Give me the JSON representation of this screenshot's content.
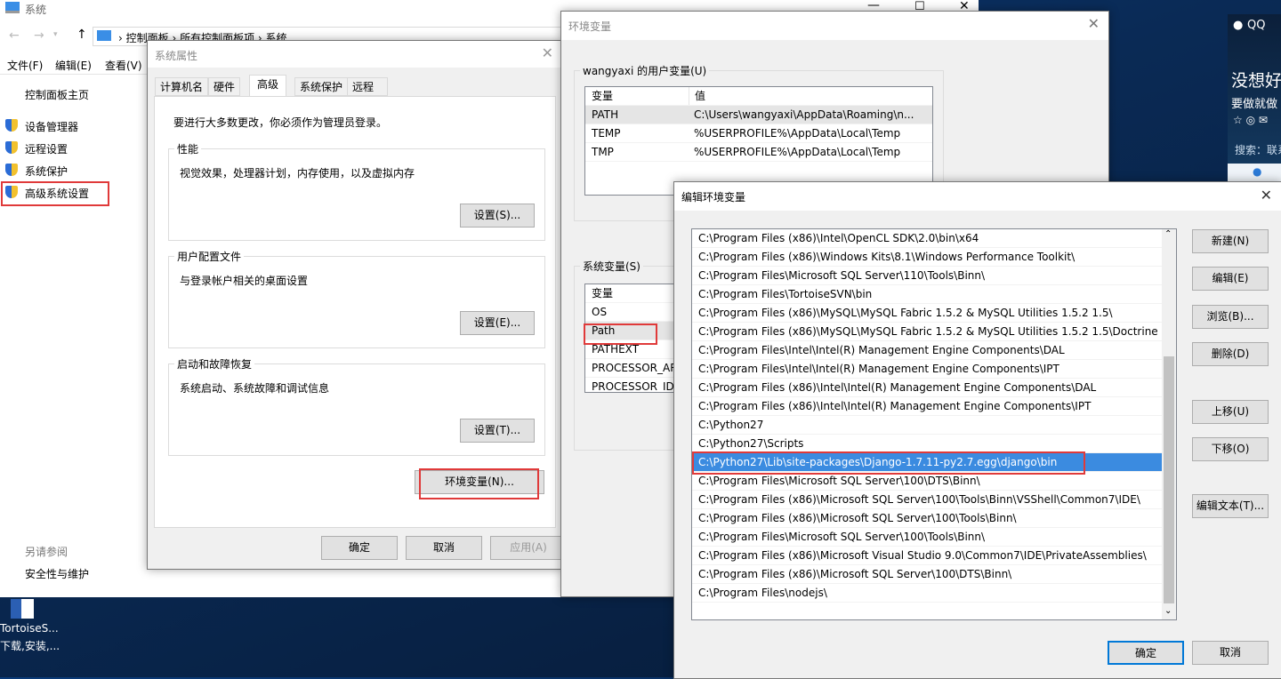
{
  "control_panel": {
    "title": "系统",
    "breadcrumb": [
      "控制面板",
      "所有控制面板项",
      "系统"
    ],
    "menu": [
      "文件(F)",
      "编辑(E)",
      "查看(V)"
    ],
    "home": "控制面板主页",
    "links": [
      "设备管理器",
      "远程设置",
      "系统保护",
      "高级系统设置"
    ],
    "see_also": "另请参阅",
    "security": "安全性与维护"
  },
  "desktop": {
    "icon_label_1": "TortoiseS...",
    "icon_label_2": "下载,安装,..."
  },
  "qq": {
    "title": "QQ",
    "line1": "没想好",
    "line2": "要做就做",
    "search": "搜索：联系"
  },
  "sysprops": {
    "title": "系统属性",
    "tabs": [
      "计算机名",
      "硬件",
      "高级",
      "系统保护",
      "远程"
    ],
    "active_tab": "高级",
    "admin_note": "要进行大多数更改，你必须作为管理员登录。",
    "perf": {
      "label": "性能",
      "desc": "视觉效果，处理器计划，内存使用，以及虚拟内存",
      "btn": "设置(S)..."
    },
    "profile": {
      "label": "用户配置文件",
      "desc": "与登录帐户相关的桌面设置",
      "btn": "设置(E)..."
    },
    "startup": {
      "label": "启动和故障恢复",
      "desc": "系统启动、系统故障和调试信息",
      "btn": "设置(T)..."
    },
    "env_btn": "环境变量(N)...",
    "ok": "确定",
    "cancel": "取消",
    "apply": "应用(A)"
  },
  "envvars": {
    "title": "环境变量",
    "user_group": "wangyaxi 的用户变量(U)",
    "col_var": "变量",
    "col_val": "值",
    "user_vars": [
      {
        "name": "PATH",
        "value": "C:\\Users\\wangyaxi\\AppData\\Roaming\\n..."
      },
      {
        "name": "TEMP",
        "value": "%USERPROFILE%\\AppData\\Local\\Temp"
      },
      {
        "name": "TMP",
        "value": "%USERPROFILE%\\AppData\\Local\\Temp"
      }
    ],
    "sys_group": "系统变量(S)",
    "sys_vars": [
      "OS",
      "Path",
      "PATHEXT",
      "PROCESSOR_AR",
      "PROCESSOR_IDE"
    ]
  },
  "edit": {
    "title": "编辑环境变量",
    "selected_index": 12,
    "paths": [
      "C:\\Program Files (x86)\\Intel\\OpenCL SDK\\2.0\\bin\\x64",
      "C:\\Program Files (x86)\\Windows Kits\\8.1\\Windows Performance Toolkit\\",
      "C:\\Program Files\\Microsoft SQL Server\\110\\Tools\\Binn\\",
      "C:\\Program Files\\TortoiseSVN\\bin",
      "C:\\Program Files (x86)\\MySQL\\MySQL Fabric 1.5.2 & MySQL Utilities 1.5.2 1.5\\",
      "C:\\Program Files (x86)\\MySQL\\MySQL Fabric 1.5.2 & MySQL Utilities 1.5.2 1.5\\Doctrine ...",
      "C:\\Program Files\\Intel\\Intel(R) Management Engine Components\\DAL",
      "C:\\Program Files\\Intel\\Intel(R) Management Engine Components\\IPT",
      "C:\\Program Files (x86)\\Intel\\Intel(R) Management Engine Components\\DAL",
      "C:\\Program Files (x86)\\Intel\\Intel(R) Management Engine Components\\IPT",
      "C:\\Python27",
      "C:\\Python27\\Scripts",
      "C:\\Python27\\Lib\\site-packages\\Django-1.7.11-py2.7.egg\\django\\bin",
      "C:\\Program Files\\Microsoft SQL Server\\100\\DTS\\Binn\\",
      "C:\\Program Files (x86)\\Microsoft SQL Server\\100\\Tools\\Binn\\VSShell\\Common7\\IDE\\",
      "C:\\Program Files (x86)\\Microsoft SQL Server\\100\\Tools\\Binn\\",
      "C:\\Program Files\\Microsoft SQL Server\\100\\Tools\\Binn\\",
      "C:\\Program Files (x86)\\Microsoft Visual Studio 9.0\\Common7\\IDE\\PrivateAssemblies\\",
      "C:\\Program Files (x86)\\Microsoft SQL Server\\100\\DTS\\Binn\\",
      "C:\\Program Files\\nodejs\\"
    ],
    "buttons": {
      "new": "新建(N)",
      "edit": "编辑(E)",
      "browse": "浏览(B)...",
      "delete": "删除(D)",
      "up": "上移(U)",
      "down": "下移(O)",
      "edit_text": "编辑文本(T)..."
    },
    "ok": "确定",
    "cancel": "取消"
  },
  "colors": {
    "selection": "#3b8be0",
    "highlight_box": "#e03a3a"
  }
}
